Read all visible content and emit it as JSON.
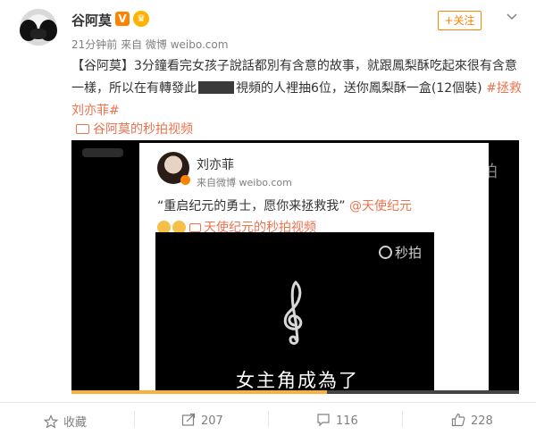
{
  "post": {
    "author": "谷阿莫",
    "v_badge": "V",
    "crown_badge": "♛",
    "meta": "21分钟前 来自 微博 weibo.com",
    "follow_label": "+关注",
    "text_prefix": "【谷阿莫】3分鐘看完女孩子說話都別有含意的故事，就跟鳳梨酥吃起來很有含意一樣，所以在有轉發此",
    "text_suffix": "視頻的人裡抽6位，送你鳳梨酥一盒(12個裝) ",
    "topic": "#拯救刘亦菲#",
    "video_link": "谷阿莫的秒拍视频"
  },
  "video": {
    "miaopai_logo": "秒拍",
    "progress": 0.57,
    "accent_color": "#fbb03b"
  },
  "repost": {
    "author": "刘亦菲",
    "meta": "来自微博 weibo.com",
    "text": "“重启纪元的勇士，愿你来拯救我” ",
    "mention": "@天使纪元",
    "video_link": "天使纪元的秒拍视频",
    "miaopai_logo": "秒拍",
    "subtitle": "女主角成為了"
  },
  "actions": {
    "favorite": "收藏",
    "repost": "207",
    "comment": "116",
    "like": "228"
  },
  "colors": {
    "brand": "#ff8200",
    "link": "#eb7350"
  }
}
